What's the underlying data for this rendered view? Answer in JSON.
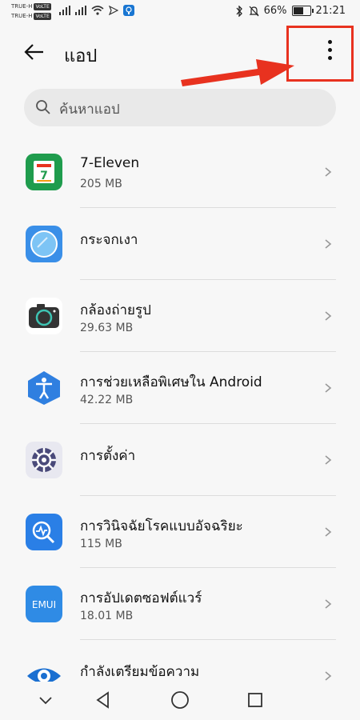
{
  "status_bar": {
    "carrier_top": "TRUE-H",
    "carrier_bottom": "TRUE-H",
    "volte_label": "VoLTE",
    "battery_percent": "66%",
    "battery_level": 0.66,
    "time": "21:21"
  },
  "app_bar": {
    "title": "แอป"
  },
  "search": {
    "placeholder": "ค้นหาแอป"
  },
  "apps": [
    {
      "name": "7-Eleven",
      "size": "205 MB",
      "icon": "seven-eleven-icon"
    },
    {
      "name": "กระจกเงา",
      "size": "",
      "icon": "mirror-icon"
    },
    {
      "name": "กล้องถ่ายรูป",
      "size": "29.63 MB",
      "icon": "camera-icon"
    },
    {
      "name": "การช่วยเหลือพิเศษใน Android",
      "size": "42.22 MB",
      "icon": "accessibility-icon"
    },
    {
      "name": "การตั้งค่า",
      "size": "",
      "icon": "settings-icon"
    },
    {
      "name": "การวินิจฉัยโรคแบบอัจฉริยะ",
      "size": "115 MB",
      "icon": "diagnosis-icon"
    },
    {
      "name": "การอัปเดตซอฟต์แวร์",
      "size": "18.01 MB",
      "icon": "emui-update-icon"
    },
    {
      "name": "กำลังเตรียมข้อความ",
      "size": "",
      "icon": "message-prep-icon"
    }
  ],
  "emui_label": "EMUI",
  "colors": {
    "highlight": "#e8321f",
    "seven_eleven_green": "#1f9c4d",
    "mirror_blue": "#3a8fe8",
    "accessibility_blue": "#2f7fe0",
    "settings_purple": "#4a4a7a",
    "diagnosis_blue": "#2a7fe6",
    "emui_blue": "#2f8be5"
  }
}
